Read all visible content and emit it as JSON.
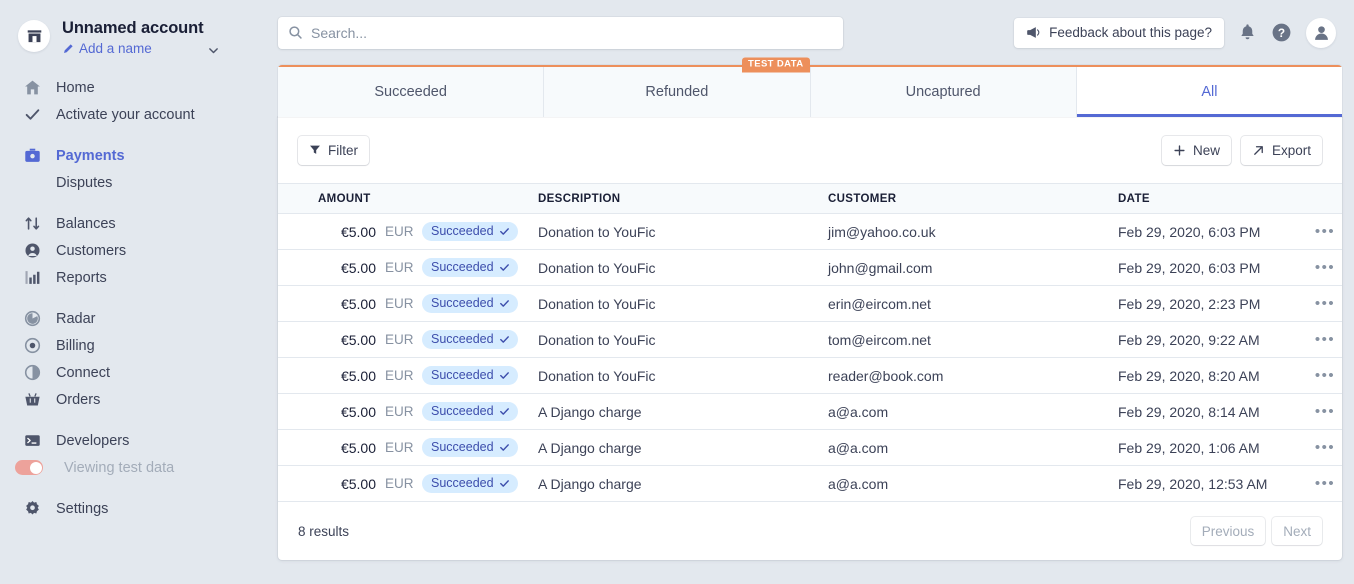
{
  "sidebar": {
    "account": {
      "name": "Unnamed account",
      "add_name_label": "Add a name",
      "avatar_icon": "store-icon",
      "chevron_icon": "chevron-down-icon",
      "pencil_icon": "pencil-icon"
    },
    "groups": [
      {
        "items": [
          {
            "label": "Home",
            "icon": "home-icon",
            "active": false
          },
          {
            "label": "Activate your account",
            "icon": "check-icon",
            "active": false
          }
        ]
      },
      {
        "items": [
          {
            "label": "Payments",
            "icon": "payments-icon",
            "active": true
          }
        ],
        "sub": [
          {
            "label": "Disputes"
          }
        ]
      },
      {
        "items": [
          {
            "label": "Balances",
            "icon": "balances-icon",
            "active": false
          },
          {
            "label": "Customers",
            "icon": "customers-icon",
            "active": false
          },
          {
            "label": "Reports",
            "icon": "reports-icon",
            "active": false
          }
        ]
      },
      {
        "items": [
          {
            "label": "Radar",
            "icon": "radar-icon",
            "active": false
          },
          {
            "label": "Billing",
            "icon": "billing-icon",
            "active": false
          },
          {
            "label": "Connect",
            "icon": "connect-icon",
            "active": false
          },
          {
            "label": "Orders",
            "icon": "orders-icon",
            "active": false
          }
        ]
      },
      {
        "items": [
          {
            "label": "Developers",
            "icon": "terminal-icon",
            "active": false
          }
        ]
      },
      {
        "items": [
          {
            "label": "Settings",
            "icon": "gear-icon",
            "active": false
          }
        ]
      }
    ],
    "test_toggle": {
      "label": "Viewing test data",
      "on": true
    }
  },
  "header": {
    "search_placeholder": "Search...",
    "search_icon": "search-icon",
    "feedback_label": "Feedback about this page?",
    "feedback_icon": "megaphone-icon",
    "notifications_icon": "bell-icon",
    "help_icon": "help-icon",
    "profile_icon": "user-avatar-icon"
  },
  "tabs": {
    "items": [
      {
        "label": "Succeeded",
        "active": false
      },
      {
        "label": "Refunded",
        "active": false
      },
      {
        "label": "Uncaptured",
        "active": false
      },
      {
        "label": "All",
        "active": true
      }
    ],
    "test_data_badge": "TEST DATA"
  },
  "toolbar": {
    "filter_label": "Filter",
    "filter_icon": "funnel-icon",
    "new_label": "New",
    "new_icon": "plus-icon",
    "export_label": "Export",
    "export_icon": "arrow-up-right-icon"
  },
  "table": {
    "columns": [
      "AMOUNT",
      "DESCRIPTION",
      "CUSTOMER",
      "DATE"
    ],
    "rows": [
      {
        "amount": "€5.00",
        "currency": "EUR",
        "status": "Succeeded",
        "description": "Donation to YouFic",
        "customer": "jim@yahoo.co.uk",
        "date": "Feb 29, 2020, 6:03 PM"
      },
      {
        "amount": "€5.00",
        "currency": "EUR",
        "status": "Succeeded",
        "description": "Donation to YouFic",
        "customer": "john@gmail.com",
        "date": "Feb 29, 2020, 6:03 PM"
      },
      {
        "amount": "€5.00",
        "currency": "EUR",
        "status": "Succeeded",
        "description": "Donation to YouFic",
        "customer": "erin@eircom.net",
        "date": "Feb 29, 2020, 2:23 PM"
      },
      {
        "amount": "€5.00",
        "currency": "EUR",
        "status": "Succeeded",
        "description": "Donation to YouFic",
        "customer": "tom@eircom.net",
        "date": "Feb 29, 2020, 9:22 AM"
      },
      {
        "amount": "€5.00",
        "currency": "EUR",
        "status": "Succeeded",
        "description": "Donation to YouFic",
        "customer": "reader@book.com",
        "date": "Feb 29, 2020, 8:20 AM"
      },
      {
        "amount": "€5.00",
        "currency": "EUR",
        "status": "Succeeded",
        "description": "A Django charge",
        "customer": "a@a.com",
        "date": "Feb 29, 2020, 8:14 AM"
      },
      {
        "amount": "€5.00",
        "currency": "EUR",
        "status": "Succeeded",
        "description": "A Django charge",
        "customer": "a@a.com",
        "date": "Feb 29, 2020, 1:06 AM"
      },
      {
        "amount": "€5.00",
        "currency": "EUR",
        "status": "Succeeded",
        "description": "A Django charge",
        "customer": "a@a.com",
        "date": "Feb 29, 2020, 12:53 AM"
      }
    ],
    "row_menu_icon": "ellipsis-icon",
    "status_check_icon": "check-icon"
  },
  "footer": {
    "results_label": "8 results",
    "previous_label": "Previous",
    "next_label": "Next"
  },
  "colors": {
    "accent": "#5469d4",
    "test_orange": "#ed8f5b",
    "sidebar_bg": "#e3e8ee",
    "badge_bg": "#d6ecff",
    "badge_text": "#3d4eac"
  }
}
